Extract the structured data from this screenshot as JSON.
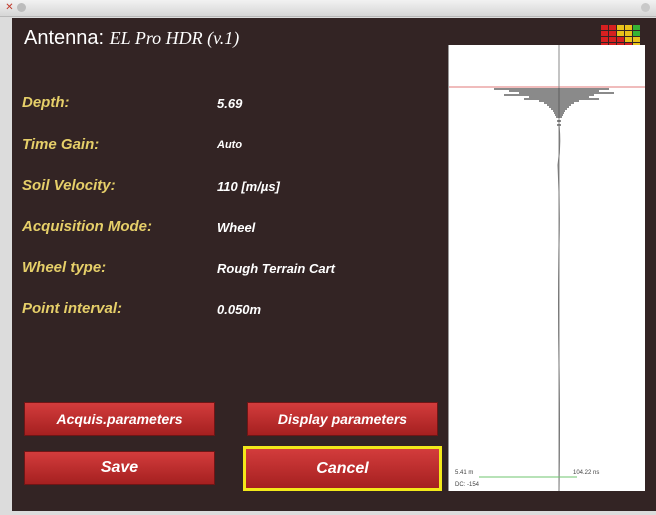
{
  "antenna": {
    "label": "Antenna:",
    "model": "EL Pro HDR (v.1)"
  },
  "params": [
    {
      "label": "Depth:",
      "value": "5.69"
    },
    {
      "label": "Time Gain:",
      "value": "Auto"
    },
    {
      "label": "Soil Velocity:",
      "value": "110 [m/µs]"
    },
    {
      "label": "Acquisition Mode:",
      "value": "Wheel"
    },
    {
      "label": "Wheel type:",
      "value": "Rough Terrain Cart"
    },
    {
      "label": "Point interval:",
      "value": "0.050m"
    }
  ],
  "buttons": {
    "acquis": "Acquis.parameters",
    "display": "Display parameters",
    "save": "Save",
    "cancel": "Cancel"
  },
  "scope": {
    "readout_left": "5.41 m",
    "readout_right": "104.22 ns",
    "dc": "DC: -154"
  },
  "colors": {
    "panel_bg": "#332424",
    "label": "#e6cf69",
    "button": "#b82a2a",
    "focus": "#f3e81a"
  },
  "icons": {
    "close": "close-icon",
    "minimize": "minimize-icon",
    "signal_meter": "signal-meter-icon"
  }
}
